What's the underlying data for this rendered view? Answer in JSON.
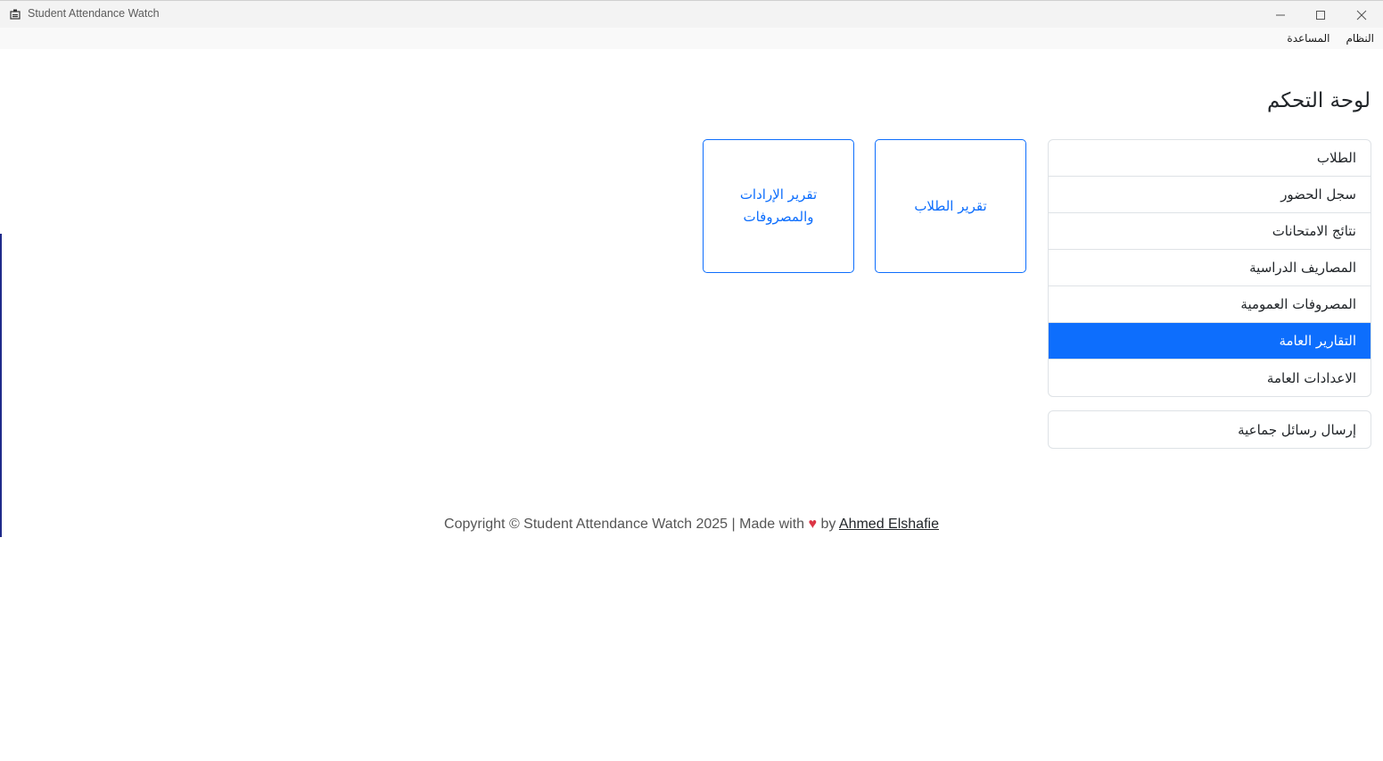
{
  "window": {
    "title": "Student Attendance Watch"
  },
  "menu": {
    "items": [
      "النظام",
      "المساعدة"
    ]
  },
  "page": {
    "title": "لوحة التحكم"
  },
  "sidebar": {
    "items": [
      {
        "label": "الطلاب",
        "active": false
      },
      {
        "label": "سجل الحضور",
        "active": false
      },
      {
        "label": "نتائج الامتحانات",
        "active": false
      },
      {
        "label": "المصاريف الدراسية",
        "active": false
      },
      {
        "label": "المصروفات العمومية",
        "active": false
      },
      {
        "label": "التقارير العامة",
        "active": true
      },
      {
        "label": "الاعدادات العامة",
        "active": false
      }
    ],
    "extra_item": "إرسال رسائل جماعية"
  },
  "reports": {
    "students_report": "تقرير الطلاب",
    "finance_report": "تقرير الإرادات والمصروفات"
  },
  "footer": {
    "copyright": "Copyright © Student Attendance Watch 2025 | Made with ",
    "by": " by ",
    "author": "Ahmed Elshafie"
  },
  "colors": {
    "accent": "#0d6efd",
    "heart": "#dc3545"
  }
}
